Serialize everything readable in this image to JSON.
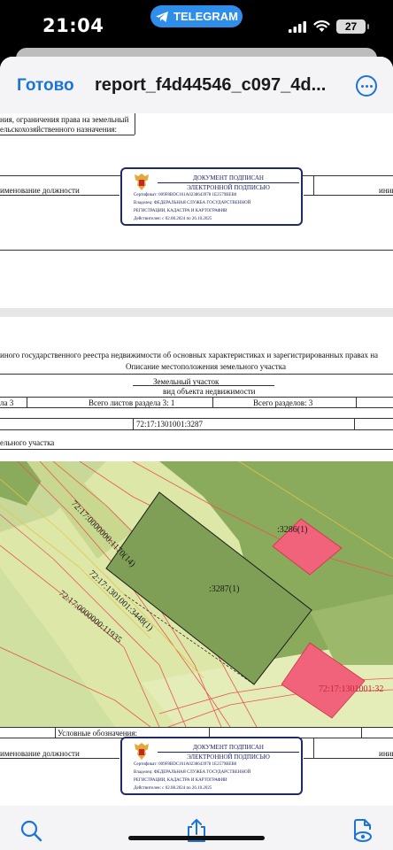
{
  "status_bar": {
    "time": "21:04",
    "back_app": "TELEGRAM",
    "battery": "27"
  },
  "navbar": {
    "done_label": "Готово",
    "title": "report_f4d44546_c097_4d..."
  },
  "page1": {
    "lines": [
      "ния, ограничения права на земельный",
      "ельскохозяйственного назначения:"
    ],
    "position_label": "именование должности",
    "right_label": "иниц"
  },
  "stamp": {
    "title": "ДОКУМЕНТ ПОДПИСАН",
    "subtitle": "ЭЛЕКТРОННОЙ ПОДПИСЬЮ",
    "certificate": "Сертификат: 009F8BDC161A0238643978 1E2579BEB0",
    "owner1": "Владелец: ФЕДЕРАЛЬНАЯ СЛУЖБА ГОСУДАРСТВЕННОЙ",
    "owner2": "РЕГИСТРАЦИИ, КАДАСТРА И КАРТОГРАФИИ",
    "valid": "Действителен: с 02.08.2024 по 26.10.2025"
  },
  "page2": {
    "header": "иного государственного реестра недвижимости об основных характеристиках и зарегистрированных правах на",
    "subheader": "Описание местоположения земельного участка",
    "object_type": "Земельный участок",
    "object_caption": "вид объекта недвижимости",
    "section": "ла 3",
    "sheets_label": "Всего листов раздела 3: 1",
    "sections_label": "Всего разделов: 3",
    "cadastral_number": "72:17:1301001:3287",
    "plot_label": "ельного участка",
    "legend_label": "Условные обозначения:",
    "position_label": "именование должности",
    "right_label": "иниц"
  },
  "map_labels": {
    "parcel_main": ":3287(1)",
    "parcel_top": ":3286(1)",
    "parcel_bottom": "72:17:1301001:32",
    "diag1": "72:17:0000000:1170(14)",
    "diag2": "72:17:1301001:3448(1)",
    "diag3": "72:17:0000000:11935"
  },
  "colors": {
    "accent": "#1d74d8",
    "map_green": "#8aaa5c",
    "map_light": "#d8e4a4",
    "parcel_pink": "#f0637a"
  },
  "toolbar": {
    "search_icon": "search-icon",
    "share_icon": "share-icon",
    "markup_icon": "markup-icon"
  }
}
